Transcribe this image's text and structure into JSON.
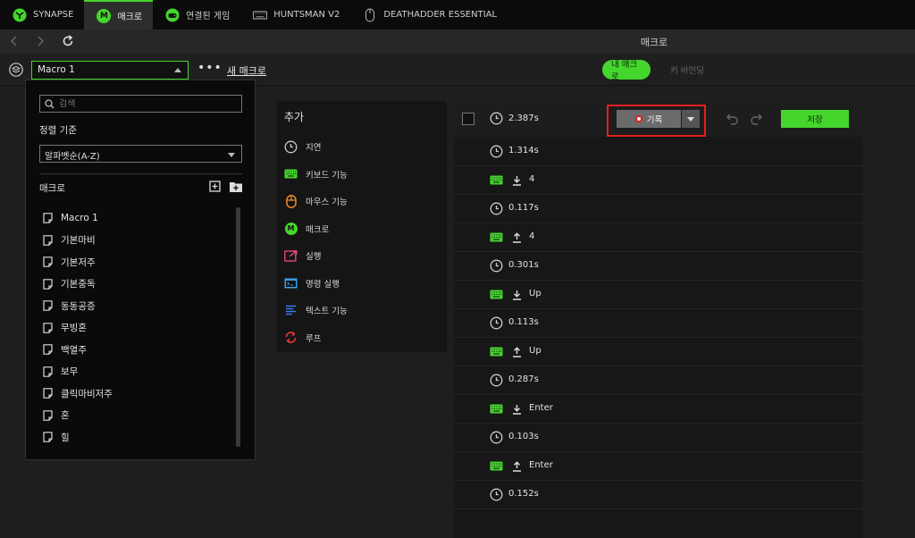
{
  "tabs": [
    {
      "label": "SYNAPSE",
      "icon": "synapse-icon"
    },
    {
      "label": "매크로",
      "icon": "macro-m-icon",
      "badge": "M"
    },
    {
      "label": "연결된 게임",
      "icon": "gamepad-icon"
    },
    {
      "label": "HUNTSMAN V2",
      "icon": "keyboard-icon"
    },
    {
      "label": "DEATHADDER ESSENTIAL",
      "icon": "mouse-icon"
    }
  ],
  "nav": {
    "page_title": "매크로"
  },
  "toolbar": {
    "macro_select_value": "Macro 1",
    "more_label": "•••",
    "new_macro_label": "새 매크로",
    "my_macros_label": "내 매크로",
    "key_binding_label": "키 바인딩"
  },
  "macro_panel": {
    "search_placeholder": "검색",
    "sort_label": "정렬 기준",
    "sort_value": "알파벳순(A-Z)",
    "macros_header": "매크로",
    "items": [
      "Macro 1",
      "기본마비",
      "기본저주",
      "기본중독",
      "동동공증",
      "무빙혼",
      "백열주",
      "보무",
      "클릭마비저주",
      "혼",
      "힐"
    ]
  },
  "add_panel": {
    "title": "추가",
    "items": [
      {
        "label": "지연",
        "icon": "clock-icon"
      },
      {
        "label": "키보드 기능",
        "icon": "keyboard-icon"
      },
      {
        "label": "마우스 기능",
        "icon": "mouse-icon"
      },
      {
        "label": "매크로",
        "icon": "macro-m-icon",
        "badge": "M"
      },
      {
        "label": "실행",
        "icon": "launch-icon"
      },
      {
        "label": "명령 실행",
        "icon": "command-icon"
      },
      {
        "label": "텍스트 기능",
        "icon": "text-icon"
      },
      {
        "label": "루프",
        "icon": "loop-icon"
      }
    ]
  },
  "sequence": {
    "record_label": "기록",
    "save_label": "저장",
    "first_delay": "2.387s",
    "rows": [
      {
        "type": "delay",
        "text": "1.314s"
      },
      {
        "type": "key-down",
        "text": "4"
      },
      {
        "type": "delay",
        "text": "0.117s"
      },
      {
        "type": "key-up",
        "text": "4"
      },
      {
        "type": "delay",
        "text": "0.301s"
      },
      {
        "type": "key-down",
        "text": "Up"
      },
      {
        "type": "delay",
        "text": "0.113s"
      },
      {
        "type": "key-up",
        "text": "Up"
      },
      {
        "type": "delay",
        "text": "0.287s"
      },
      {
        "type": "key-down",
        "text": "Enter"
      },
      {
        "type": "delay",
        "text": "0.103s"
      },
      {
        "type": "key-up",
        "text": "Enter"
      },
      {
        "type": "delay",
        "text": "0.152s"
      }
    ]
  },
  "colors": {
    "accent": "#44d62c",
    "record_highlight": "#e41e1e",
    "background": "#1e1e1e"
  }
}
